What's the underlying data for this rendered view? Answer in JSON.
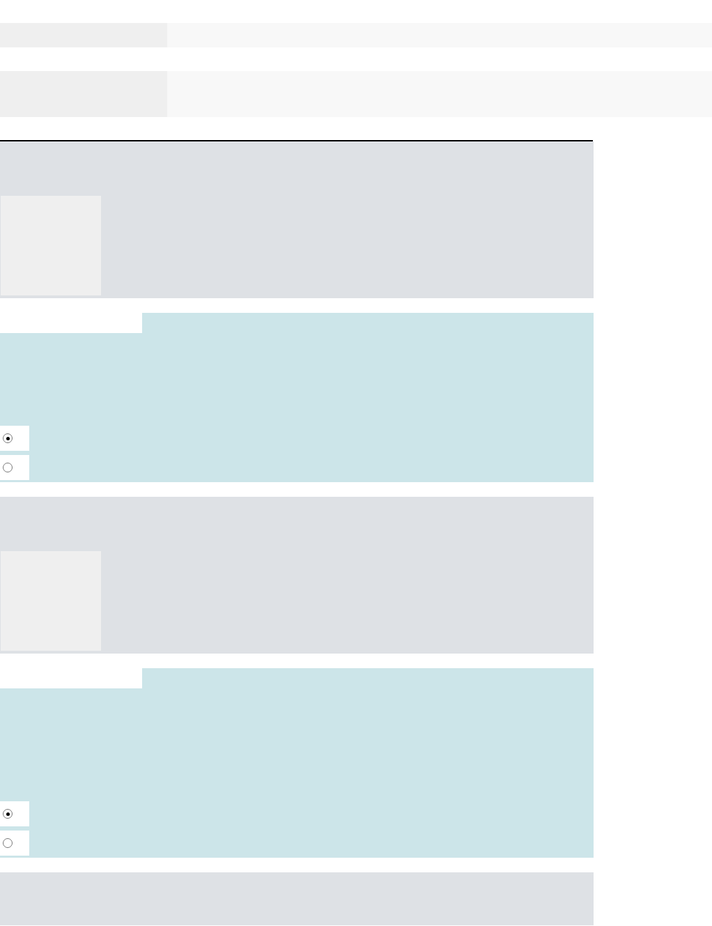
{
  "blocks": [
    {
      "kind": "row"
    },
    {
      "kind": "box"
    },
    {
      "kind": "question"
    },
    {
      "kind": "choice",
      "options": [
        {
          "selected": true
        },
        {
          "selected": false
        }
      ]
    },
    {
      "kind": "question"
    },
    {
      "kind": "choice",
      "options": [
        {
          "selected": true
        },
        {
          "selected": false
        }
      ]
    },
    {
      "kind": "footer"
    }
  ]
}
